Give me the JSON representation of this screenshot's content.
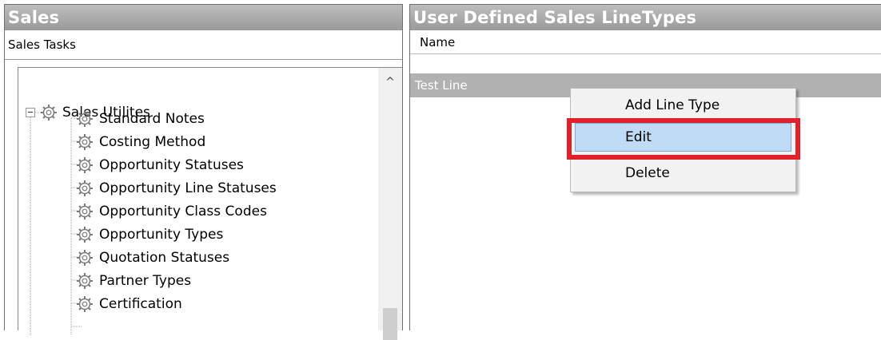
{
  "left_panel": {
    "title": "Sales",
    "tasks_label": "Sales Tasks",
    "tree": {
      "root_label": "Sales Utilites",
      "items": [
        {
          "label": "Standard Notes"
        },
        {
          "label": "Costing Method"
        },
        {
          "label": "Opportunity Statuses"
        },
        {
          "label": "Opportunity Line Statuses"
        },
        {
          "label": "Opportunity Class Codes"
        },
        {
          "label": "Opportunity Types"
        },
        {
          "label": "Quotation Statuses"
        },
        {
          "label": "Partner Types"
        },
        {
          "label": "Certification"
        }
      ]
    },
    "scroll_up_glyph": "^"
  },
  "right_panel": {
    "title": "User Defined Sales LineTypes",
    "column_header": "Name",
    "rows": [
      {
        "name": "Test Line"
      }
    ]
  },
  "context_menu": {
    "items": [
      {
        "label": "Add Line Type"
      },
      {
        "label": "Edit"
      },
      {
        "label": "Delete"
      }
    ]
  },
  "colors": {
    "header_gradient_top": "#bdbdbd",
    "header_gradient_bottom": "#9a9a9a",
    "selected_row": "#b1b1b1",
    "menu_hover": "#bfdbf5",
    "highlight_red": "#e0202b"
  }
}
